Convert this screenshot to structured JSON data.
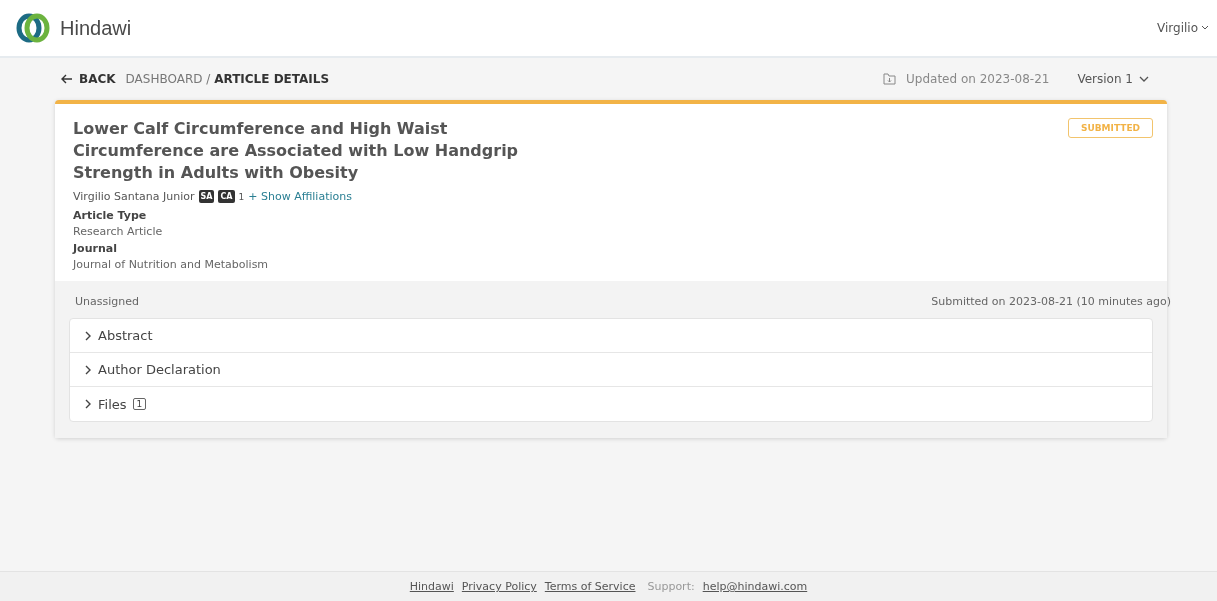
{
  "header": {
    "brand": "Hindawi",
    "user": "Virgilio"
  },
  "breadcrumb": {
    "back": "BACK",
    "parent": "DASHBOARD",
    "separator": "/",
    "current": "ARTICLE DETAILS"
  },
  "meta": {
    "updated": "Updated on 2023-08-21",
    "version": "Version 1"
  },
  "article": {
    "title": "Lower Calf Circumference and High Waist Circumference are Associated with Low Handgrip Strength in Adults with Obesity",
    "status": "SUBMITTED",
    "author": "Virgilio Santana Junior",
    "author_tags": [
      "SA",
      "CA"
    ],
    "affiliation_ref": "1",
    "affiliations_link": "+ Show Affiliations",
    "fields": [
      {
        "label": "Article Type",
        "value": "Research Article"
      },
      {
        "label": "Journal",
        "value": "Journal of Nutrition and Metabolism"
      }
    ]
  },
  "assignment": {
    "assignee": "Unassigned",
    "submitted": "Submitted on 2023-08-21 (10 minutes ago)"
  },
  "sections": [
    {
      "label": "Abstract",
      "expanded": false
    },
    {
      "label": "Author Declaration",
      "expanded": false
    },
    {
      "label": "Files",
      "expanded": false,
      "count": "1"
    }
  ],
  "footer": {
    "links": [
      "Hindawi",
      "Privacy Policy",
      "Terms of Service"
    ],
    "support_label": "Support:",
    "support_email": "help@hindawi.com"
  }
}
